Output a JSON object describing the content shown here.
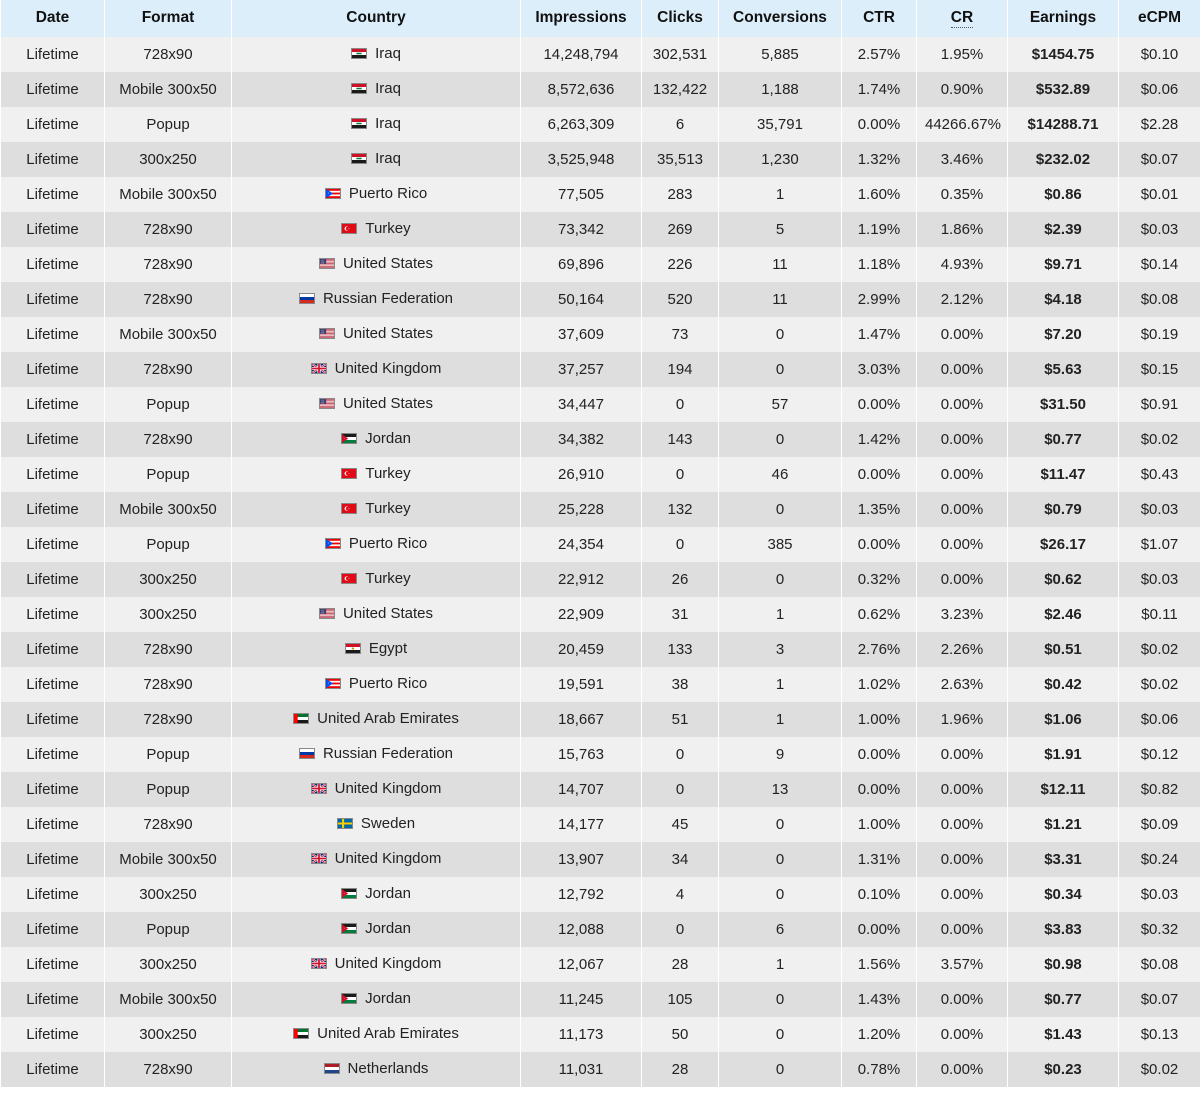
{
  "table": {
    "headers": [
      {
        "key": "date",
        "label": "Date"
      },
      {
        "key": "format",
        "label": "Format"
      },
      {
        "key": "country",
        "label": "Country"
      },
      {
        "key": "impressions",
        "label": "Impressions"
      },
      {
        "key": "clicks",
        "label": "Clicks"
      },
      {
        "key": "conversions",
        "label": "Conversions"
      },
      {
        "key": "ctr",
        "label": "CTR"
      },
      {
        "key": "cr",
        "label": "CR"
      },
      {
        "key": "earnings",
        "label": "Earnings"
      },
      {
        "key": "ecpm",
        "label": "eCPM"
      }
    ],
    "header_bg": "#ddeefb",
    "row_bg_odd": "#f0f0f0",
    "row_bg_even": "#dedede",
    "rows": [
      {
        "date": "Lifetime",
        "format": "728x90",
        "flag": "iraq-flag-icon",
        "country": "Iraq",
        "impressions": "14,248,794",
        "clicks": "302,531",
        "conversions": "5,885",
        "ctr": "2.57%",
        "cr": "1.95%",
        "earnings": "$1454.75",
        "ecpm": "$0.10"
      },
      {
        "date": "Lifetime",
        "format": "Mobile 300x50",
        "flag": "iraq-flag-icon",
        "country": "Iraq",
        "impressions": "8,572,636",
        "clicks": "132,422",
        "conversions": "1,188",
        "ctr": "1.74%",
        "cr": "0.90%",
        "earnings": "$532.89",
        "ecpm": "$0.06"
      },
      {
        "date": "Lifetime",
        "format": "Popup",
        "flag": "iraq-flag-icon",
        "country": "Iraq",
        "impressions": "6,263,309",
        "clicks": "6",
        "conversions": "35,791",
        "ctr": "0.00%",
        "cr": "44266.67%",
        "earnings": "$14288.71",
        "ecpm": "$2.28"
      },
      {
        "date": "Lifetime",
        "format": "300x250",
        "flag": "iraq-flag-icon",
        "country": "Iraq",
        "impressions": "3,525,948",
        "clicks": "35,513",
        "conversions": "1,230",
        "ctr": "1.32%",
        "cr": "3.46%",
        "earnings": "$232.02",
        "ecpm": "$0.07"
      },
      {
        "date": "Lifetime",
        "format": "Mobile 300x50",
        "flag": "puerto-rico-flag-icon",
        "country": "Puerto Rico",
        "impressions": "77,505",
        "clicks": "283",
        "conversions": "1",
        "ctr": "1.60%",
        "cr": "0.35%",
        "earnings": "$0.86",
        "ecpm": "$0.01"
      },
      {
        "date": "Lifetime",
        "format": "728x90",
        "flag": "turkey-flag-icon",
        "country": "Turkey",
        "impressions": "73,342",
        "clicks": "269",
        "conversions": "5",
        "ctr": "1.19%",
        "cr": "1.86%",
        "earnings": "$2.39",
        "ecpm": "$0.03"
      },
      {
        "date": "Lifetime",
        "format": "728x90",
        "flag": "united-states-flag-icon",
        "country": "United States",
        "impressions": "69,896",
        "clicks": "226",
        "conversions": "11",
        "ctr": "1.18%",
        "cr": "4.93%",
        "earnings": "$9.71",
        "ecpm": "$0.14"
      },
      {
        "date": "Lifetime",
        "format": "728x90",
        "flag": "russian-federation-flag-icon",
        "country": "Russian Federation",
        "impressions": "50,164",
        "clicks": "520",
        "conversions": "11",
        "ctr": "2.99%",
        "cr": "2.12%",
        "earnings": "$4.18",
        "ecpm": "$0.08"
      },
      {
        "date": "Lifetime",
        "format": "Mobile 300x50",
        "flag": "united-states-flag-icon",
        "country": "United States",
        "impressions": "37,609",
        "clicks": "73",
        "conversions": "0",
        "ctr": "1.47%",
        "cr": "0.00%",
        "earnings": "$7.20",
        "ecpm": "$0.19"
      },
      {
        "date": "Lifetime",
        "format": "728x90",
        "flag": "united-kingdom-flag-icon",
        "country": "United Kingdom",
        "impressions": "37,257",
        "clicks": "194",
        "conversions": "0",
        "ctr": "3.03%",
        "cr": "0.00%",
        "earnings": "$5.63",
        "ecpm": "$0.15"
      },
      {
        "date": "Lifetime",
        "format": "Popup",
        "flag": "united-states-flag-icon",
        "country": "United States",
        "impressions": "34,447",
        "clicks": "0",
        "conversions": "57",
        "ctr": "0.00%",
        "cr": "0.00%",
        "earnings": "$31.50",
        "ecpm": "$0.91"
      },
      {
        "date": "Lifetime",
        "format": "728x90",
        "flag": "jordan-flag-icon",
        "country": "Jordan",
        "impressions": "34,382",
        "clicks": "143",
        "conversions": "0",
        "ctr": "1.42%",
        "cr": "0.00%",
        "earnings": "$0.77",
        "ecpm": "$0.02"
      },
      {
        "date": "Lifetime",
        "format": "Popup",
        "flag": "turkey-flag-icon",
        "country": "Turkey",
        "impressions": "26,910",
        "clicks": "0",
        "conversions": "46",
        "ctr": "0.00%",
        "cr": "0.00%",
        "earnings": "$11.47",
        "ecpm": "$0.43"
      },
      {
        "date": "Lifetime",
        "format": "Mobile 300x50",
        "flag": "turkey-flag-icon",
        "country": "Turkey",
        "impressions": "25,228",
        "clicks": "132",
        "conversions": "0",
        "ctr": "1.35%",
        "cr": "0.00%",
        "earnings": "$0.79",
        "ecpm": "$0.03"
      },
      {
        "date": "Lifetime",
        "format": "Popup",
        "flag": "puerto-rico-flag-icon",
        "country": "Puerto Rico",
        "impressions": "24,354",
        "clicks": "0",
        "conversions": "385",
        "ctr": "0.00%",
        "cr": "0.00%",
        "earnings": "$26.17",
        "ecpm": "$1.07"
      },
      {
        "date": "Lifetime",
        "format": "300x250",
        "flag": "turkey-flag-icon",
        "country": "Turkey",
        "impressions": "22,912",
        "clicks": "26",
        "conversions": "0",
        "ctr": "0.32%",
        "cr": "0.00%",
        "earnings": "$0.62",
        "ecpm": "$0.03"
      },
      {
        "date": "Lifetime",
        "format": "300x250",
        "flag": "united-states-flag-icon",
        "country": "United States",
        "impressions": "22,909",
        "clicks": "31",
        "conversions": "1",
        "ctr": "0.62%",
        "cr": "3.23%",
        "earnings": "$2.46",
        "ecpm": "$0.11"
      },
      {
        "date": "Lifetime",
        "format": "728x90",
        "flag": "egypt-flag-icon",
        "country": "Egypt",
        "impressions": "20,459",
        "clicks": "133",
        "conversions": "3",
        "ctr": "2.76%",
        "cr": "2.26%",
        "earnings": "$0.51",
        "ecpm": "$0.02"
      },
      {
        "date": "Lifetime",
        "format": "728x90",
        "flag": "puerto-rico-flag-icon",
        "country": "Puerto Rico",
        "impressions": "19,591",
        "clicks": "38",
        "conversions": "1",
        "ctr": "1.02%",
        "cr": "2.63%",
        "earnings": "$0.42",
        "ecpm": "$0.02"
      },
      {
        "date": "Lifetime",
        "format": "728x90",
        "flag": "united-arab-emirates-flag-icon",
        "country": "United Arab Emirates",
        "impressions": "18,667",
        "clicks": "51",
        "conversions": "1",
        "ctr": "1.00%",
        "cr": "1.96%",
        "earnings": "$1.06",
        "ecpm": "$0.06"
      },
      {
        "date": "Lifetime",
        "format": "Popup",
        "flag": "russian-federation-flag-icon",
        "country": "Russian Federation",
        "impressions": "15,763",
        "clicks": "0",
        "conversions": "9",
        "ctr": "0.00%",
        "cr": "0.00%",
        "earnings": "$1.91",
        "ecpm": "$0.12"
      },
      {
        "date": "Lifetime",
        "format": "Popup",
        "flag": "united-kingdom-flag-icon",
        "country": "United Kingdom",
        "impressions": "14,707",
        "clicks": "0",
        "conversions": "13",
        "ctr": "0.00%",
        "cr": "0.00%",
        "earnings": "$12.11",
        "ecpm": "$0.82"
      },
      {
        "date": "Lifetime",
        "format": "728x90",
        "flag": "sweden-flag-icon",
        "country": "Sweden",
        "impressions": "14,177",
        "clicks": "45",
        "conversions": "0",
        "ctr": "1.00%",
        "cr": "0.00%",
        "earnings": "$1.21",
        "ecpm": "$0.09"
      },
      {
        "date": "Lifetime",
        "format": "Mobile 300x50",
        "flag": "united-kingdom-flag-icon",
        "country": "United Kingdom",
        "impressions": "13,907",
        "clicks": "34",
        "conversions": "0",
        "ctr": "1.31%",
        "cr": "0.00%",
        "earnings": "$3.31",
        "ecpm": "$0.24"
      },
      {
        "date": "Lifetime",
        "format": "300x250",
        "flag": "jordan-flag-icon",
        "country": "Jordan",
        "impressions": "12,792",
        "clicks": "4",
        "conversions": "0",
        "ctr": "0.10%",
        "cr": "0.00%",
        "earnings": "$0.34",
        "ecpm": "$0.03"
      },
      {
        "date": "Lifetime",
        "format": "Popup",
        "flag": "jordan-flag-icon",
        "country": "Jordan",
        "impressions": "12,088",
        "clicks": "0",
        "conversions": "6",
        "ctr": "0.00%",
        "cr": "0.00%",
        "earnings": "$3.83",
        "ecpm": "$0.32"
      },
      {
        "date": "Lifetime",
        "format": "300x250",
        "flag": "united-kingdom-flag-icon",
        "country": "United Kingdom",
        "impressions": "12,067",
        "clicks": "28",
        "conversions": "1",
        "ctr": "1.56%",
        "cr": "3.57%",
        "earnings": "$0.98",
        "ecpm": "$0.08"
      },
      {
        "date": "Lifetime",
        "format": "Mobile 300x50",
        "flag": "jordan-flag-icon",
        "country": "Jordan",
        "impressions": "11,245",
        "clicks": "105",
        "conversions": "0",
        "ctr": "1.43%",
        "cr": "0.00%",
        "earnings": "$0.77",
        "ecpm": "$0.07"
      },
      {
        "date": "Lifetime",
        "format": "300x250",
        "flag": "united-arab-emirates-flag-icon",
        "country": "United Arab Emirates",
        "impressions": "11,173",
        "clicks": "50",
        "conversions": "0",
        "ctr": "1.20%",
        "cr": "0.00%",
        "earnings": "$1.43",
        "ecpm": "$0.13"
      },
      {
        "date": "Lifetime",
        "format": "728x90",
        "flag": "netherlands-flag-icon",
        "country": "Netherlands",
        "impressions": "11,031",
        "clicks": "28",
        "conversions": "0",
        "ctr": "0.78%",
        "cr": "0.00%",
        "earnings": "$0.23",
        "ecpm": "$0.02"
      }
    ]
  }
}
